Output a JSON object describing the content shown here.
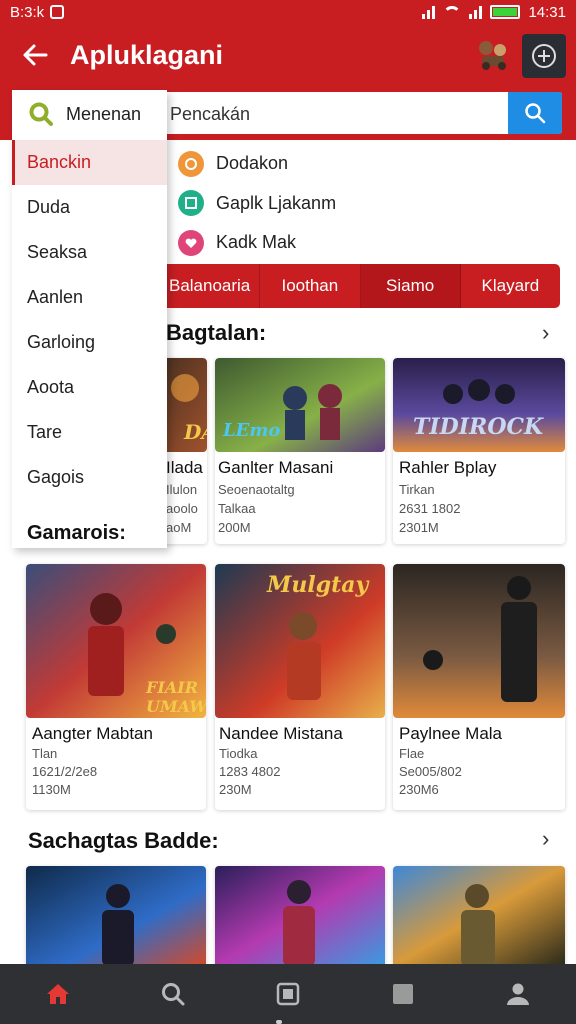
{
  "status_bar": {
    "time_left": "B:3:k",
    "time_right": "14:31"
  },
  "app_bar": {
    "title": "Apluklagani"
  },
  "search": {
    "scope_label": "Menenan",
    "placeholder": "Pencakán"
  },
  "side_menu": {
    "items": [
      "Banckin",
      "Duda",
      "Seaksa",
      "Aanlen",
      "Garloing",
      "Aoota",
      "Tare",
      "Gagois"
    ],
    "active_index": 0,
    "section_title": "Gamarois:"
  },
  "quick_links": [
    {
      "label": "Dodakon",
      "icon": "coin-icon",
      "color": "#f0963a"
    },
    {
      "label": "Gaplk Ljakanm",
      "icon": "cube-icon",
      "color": "#1fb08a"
    },
    {
      "label": "Kadk Mak",
      "icon": "heart-icon",
      "color": "#e0457a"
    }
  ],
  "tabs": [
    "Balanoaria",
    "Ioothan",
    "Siamo",
    "Klayard"
  ],
  "selected_tab": 2,
  "sections": {
    "first": "Bagtalan:",
    "third": "Sachagtas Badde:"
  },
  "colors": {
    "brand": "#c81e22",
    "accent": "#1f8de3",
    "nav_bg": "#2f3034",
    "active_nav": "#e53935"
  },
  "row1_cards": [
    {
      "name": "Ilada",
      "line1": "Ilulon",
      "line2": "aoolo",
      "line3": "aoM",
      "art": "DA",
      "palette": [
        "#3b2a1e",
        "#a0522d",
        "#f4a340"
      ]
    },
    {
      "name": "Ganlter Masani",
      "line1": "Seoenaotaltg",
      "line2": "Talkaa",
      "line3": "200M",
      "art": "LEmo",
      "palette": [
        "#3d5a30",
        "#87b048",
        "#5c3b7e"
      ]
    },
    {
      "name": "Rahler Bplay",
      "line1": "Tirkan",
      "line2": "2631 1802",
      "line3": "2301M",
      "art": "TIDIROCK",
      "palette": [
        "#2a1f4a",
        "#5b4a9e",
        "#e08a3c"
      ]
    }
  ],
  "row2_cards": [
    {
      "name": "Aangter Mabtan",
      "line1": "Tlan",
      "line2": "1621/2/2e8",
      "line3": "1130M",
      "art": "FIAIR UMAW",
      "palette": [
        "#3a4e7a",
        "#c23a36",
        "#f2b441"
      ]
    },
    {
      "name": "Nandee Mistana",
      "line1": "Tiodka",
      "line2": "1283 4802",
      "line3": "230M",
      "art": "Mulgtay",
      "palette": [
        "#1e3a52",
        "#cf3b27",
        "#e8b04a"
      ]
    },
    {
      "name": "Paylnee Mala",
      "line1": "Flae",
      "line2": "Se005/802",
      "line3": "230M6",
      "art": "",
      "palette": [
        "#2b2622",
        "#7a5a42",
        "#e08a3a"
      ]
    }
  ],
  "row3_cards": [
    {
      "palette": [
        "#0f2a4a",
        "#2f6cc7",
        "#d24a2a"
      ]
    },
    {
      "palette": [
        "#2a1f5a",
        "#b43ab0",
        "#3a9ae0"
      ]
    },
    {
      "palette": [
        "#2a2a1a",
        "#d89a3a",
        "#3e88d8"
      ]
    }
  ],
  "bottom_nav": [
    {
      "icon": "home-icon",
      "active": true
    },
    {
      "icon": "search-icon",
      "active": false
    },
    {
      "icon": "tablet-icon",
      "active": false
    },
    {
      "icon": "square-icon",
      "active": false
    },
    {
      "icon": "profile-icon",
      "active": false
    }
  ]
}
